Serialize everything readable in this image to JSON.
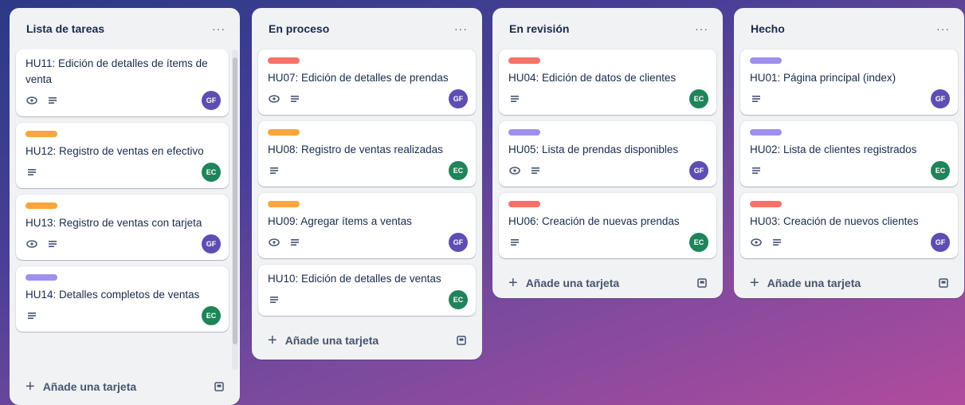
{
  "colors": {
    "orange": "#faa53d",
    "red": "#f87168",
    "purple": "#9f8fef",
    "avatar_gf": "#5e4db2",
    "avatar_ec": "#1f845a"
  },
  "lists": [
    {
      "title": "Lista de tareas",
      "menu": "···",
      "add_label": "Añade una tarjeta",
      "cards": [
        {
          "label": "",
          "title": "HU11: Edición de detalles de ítems de venta",
          "watch": true,
          "avatar": "GF"
        },
        {
          "label": "orange",
          "title": "HU12: Registro de ventas en efectivo",
          "watch": false,
          "avatar": "EC"
        },
        {
          "label": "orange",
          "title": "HU13: Registro de ventas con tarjeta",
          "watch": true,
          "avatar": "GF"
        },
        {
          "label": "purple",
          "title": "HU14: Detalles completos de ventas",
          "watch": false,
          "avatar": "EC"
        }
      ]
    },
    {
      "title": "En proceso",
      "menu": "···",
      "add_label": "Añade una tarjeta",
      "cards": [
        {
          "label": "red",
          "title": "HU07: Edición de detalles de prendas",
          "watch": true,
          "avatar": "GF"
        },
        {
          "label": "orange",
          "title": "HU08: Registro de ventas realizadas",
          "watch": false,
          "avatar": "EC"
        },
        {
          "label": "orange",
          "title": "HU09: Agregar ítems a ventas",
          "watch": true,
          "avatar": "GF"
        },
        {
          "label": "",
          "title": "HU10: Edición de detalles de ventas",
          "watch": false,
          "avatar": "EC"
        }
      ]
    },
    {
      "title": "En revisión",
      "menu": "···",
      "add_label": "Añade una tarjeta",
      "cards": [
        {
          "label": "red",
          "title": "HU04: Edición de datos de clientes",
          "watch": false,
          "avatar": "EC"
        },
        {
          "label": "purple",
          "title": "HU05: Lista de prendas disponibles",
          "watch": true,
          "avatar": "GF"
        },
        {
          "label": "red",
          "title": "HU06: Creación de nuevas prendas",
          "watch": false,
          "avatar": "EC"
        }
      ]
    },
    {
      "title": "Hecho",
      "menu": "···",
      "add_label": "Añade una tarjeta",
      "cards": [
        {
          "label": "purple",
          "title": "HU01: Página principal (index)",
          "watch": false,
          "avatar": "GF"
        },
        {
          "label": "purple",
          "title": "HU02: Lista de clientes registrados",
          "watch": false,
          "avatar": "EC"
        },
        {
          "label": "red",
          "title": "HU03: Creación de nuevos clientes",
          "watch": true,
          "avatar": "GF"
        }
      ]
    }
  ]
}
